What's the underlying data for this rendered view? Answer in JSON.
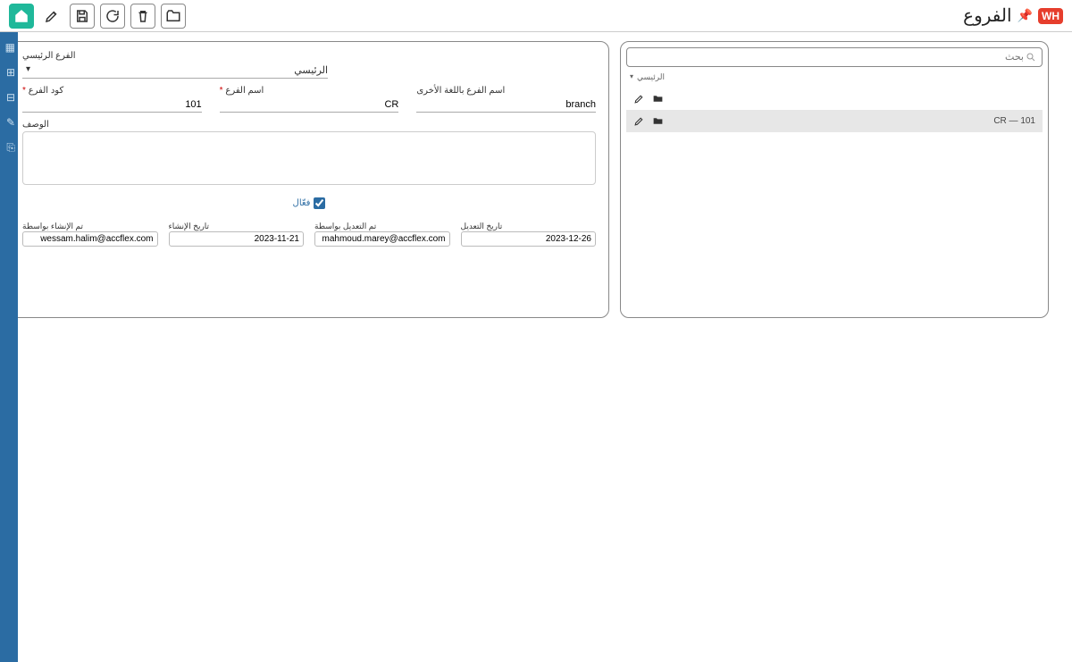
{
  "header": {
    "logo": "WH",
    "title": "الفروع"
  },
  "search": {
    "placeholder": "بحث"
  },
  "tree": {
    "root_label": "الرئيسي",
    "items": [
      {
        "label": ""
      },
      {
        "label": "CR — 101"
      }
    ]
  },
  "form": {
    "parent_label": "الفرع الرئيسي",
    "parent_value": "الرئيسي",
    "code_label": "كود الفرع",
    "code_value": "101",
    "arabic_name_label": "اسم الفرع",
    "arabic_name_value": "CR",
    "english_name_label": "اسم الفرع باللغة الأخرى",
    "english_name_value": "branch",
    "description_label": "الوصف",
    "description_value": "",
    "active_label": "فعّال",
    "created_by_label": "تم الإنشاء بواسطة",
    "created_by_value": "wessam.halim@accflex.com",
    "created_at_label": "تاريخ الإنشاء",
    "created_at_value": "2023-11-21",
    "modified_by_label": "تم التعديل بواسطة",
    "modified_by_value": "mahmoud.marey@accflex.com",
    "modified_at_label": "تاريخ التعديل",
    "modified_at_value": "2023-12-26"
  }
}
